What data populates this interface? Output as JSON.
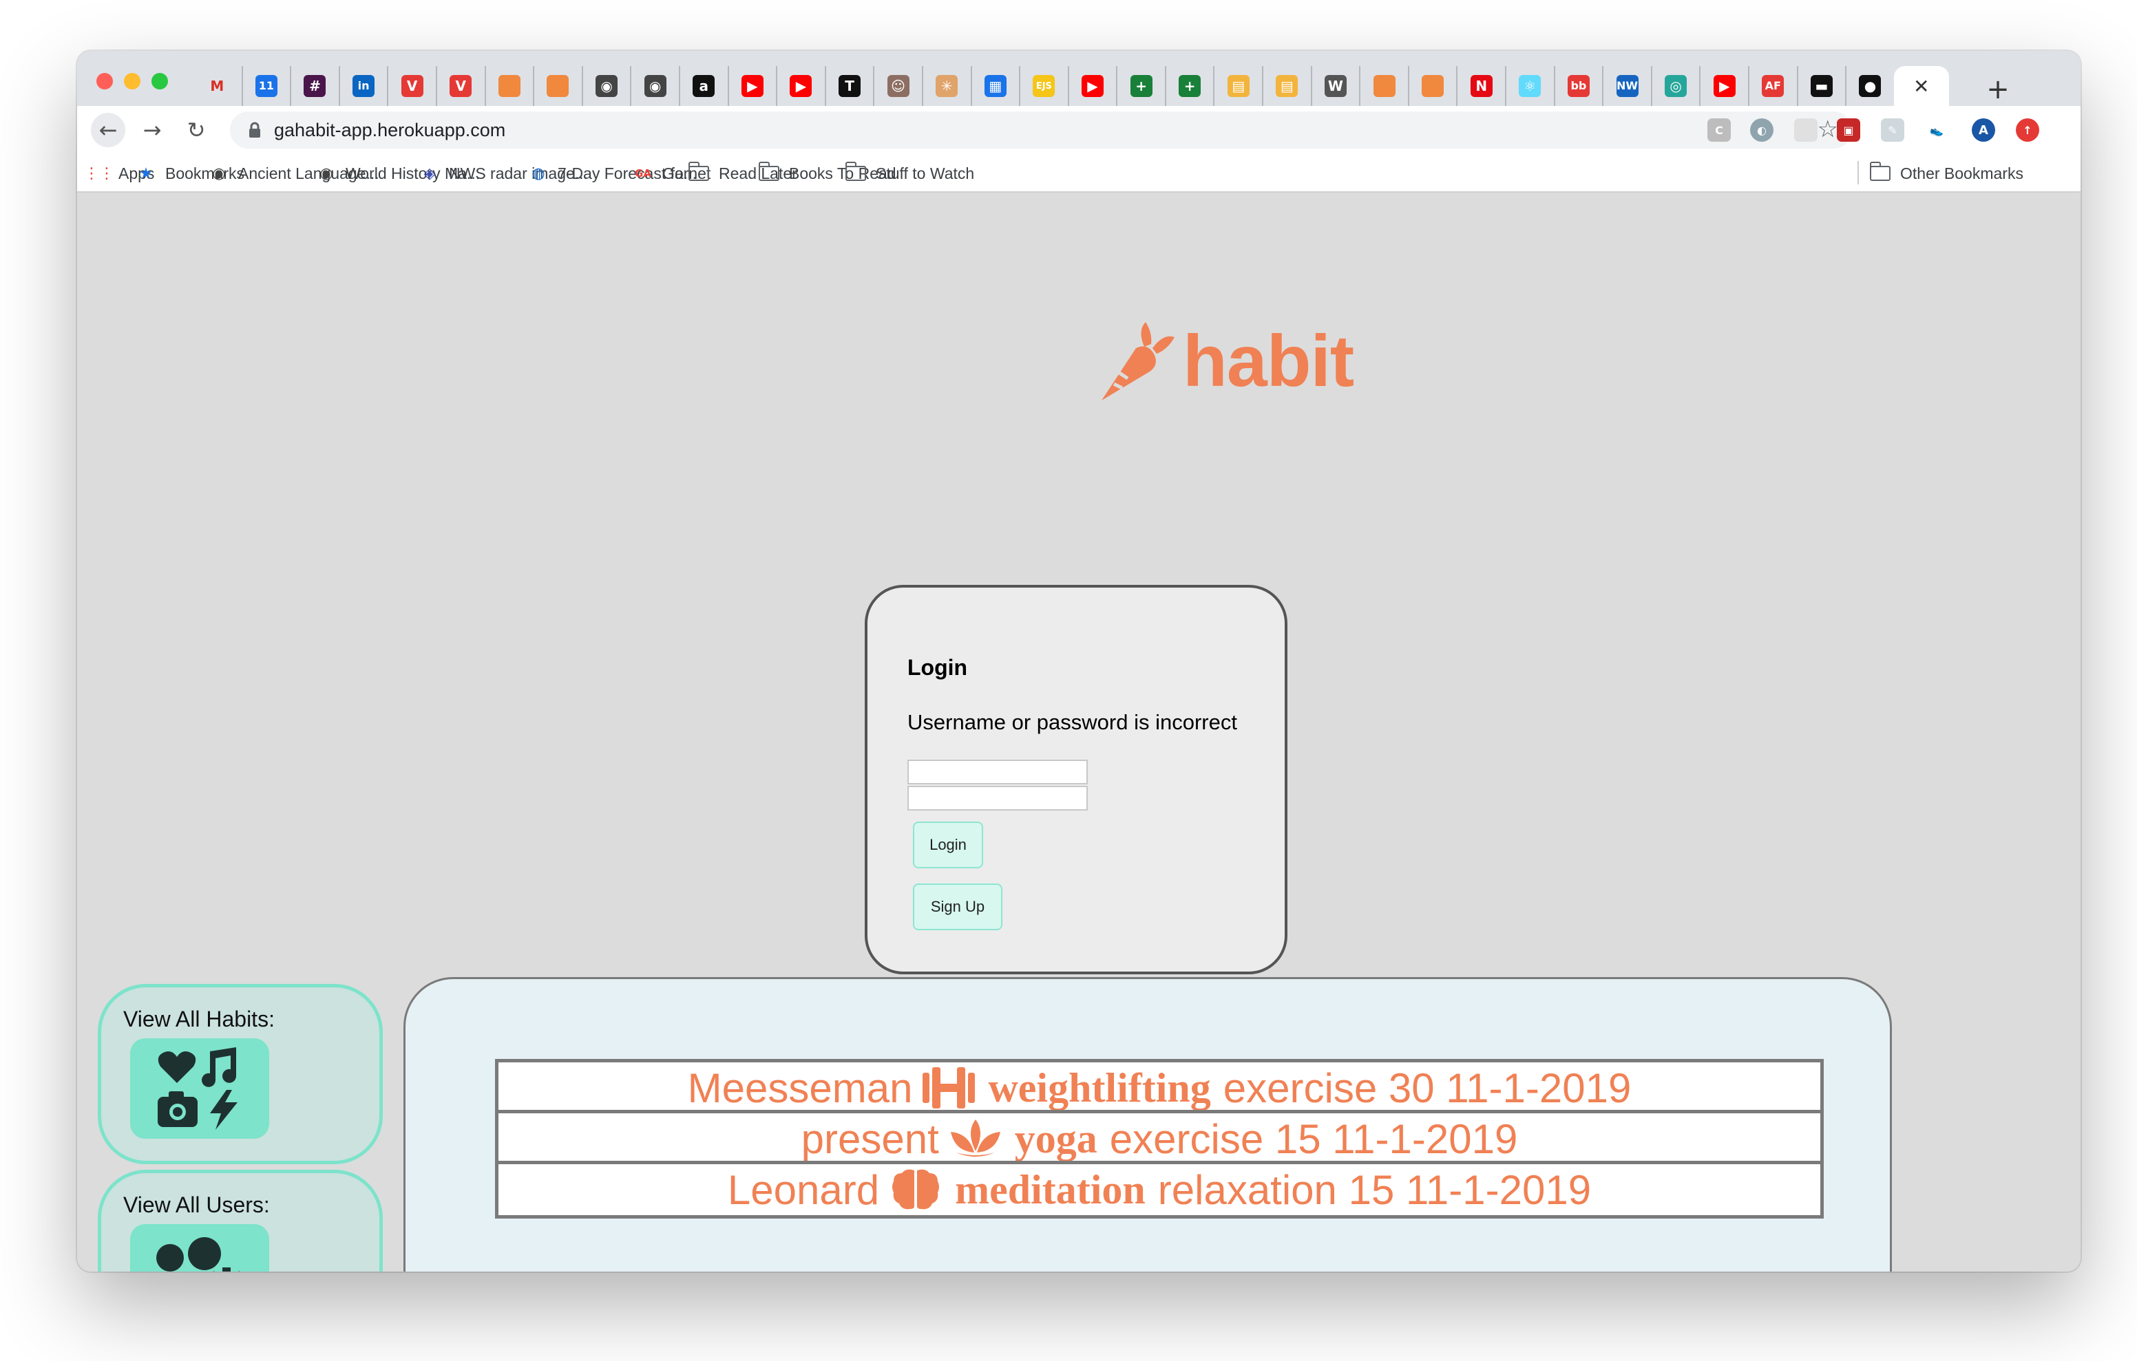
{
  "browser": {
    "tabs": [
      {
        "icon": "gmail-icon",
        "glyph": "M",
        "color": "#d93025",
        "text_color": "#d93025",
        "bg": "transparent"
      },
      {
        "icon": "calendar-icon",
        "glyph": "11",
        "color": "#1a73e8"
      },
      {
        "icon": "slack-icon",
        "glyph": "#",
        "color": "#4a154b"
      },
      {
        "icon": "linkedin-icon",
        "glyph": "in",
        "color": "#0a66c2"
      },
      {
        "icon": "v-red-icon",
        "glyph": "V",
        "color": "#e53935"
      },
      {
        "icon": "v-red-icon",
        "glyph": "V",
        "color": "#e53935"
      },
      {
        "icon": "cube-orange-icon",
        "glyph": "",
        "color": "#f0883e"
      },
      {
        "icon": "cube-orange-icon",
        "glyph": "",
        "color": "#f0883e"
      },
      {
        "icon": "globe-icon",
        "glyph": "◉",
        "color": "#444444"
      },
      {
        "icon": "globe-icon",
        "glyph": "◉",
        "color": "#444444"
      },
      {
        "icon": "amazon-icon",
        "glyph": "a",
        "color": "#111111"
      },
      {
        "icon": "youtube-icon",
        "glyph": "▶",
        "color": "#ff0000"
      },
      {
        "icon": "youtube-icon",
        "glyph": "▶",
        "color": "#ff0000"
      },
      {
        "icon": "nytimes-icon",
        "glyph": "T",
        "color": "#111111"
      },
      {
        "icon": "meerkat-icon",
        "glyph": "☺",
        "color": "#8d6e63"
      },
      {
        "icon": "asterisk-icon",
        "glyph": "✳",
        "color": "#e0a36a"
      },
      {
        "icon": "grid-blue-icon",
        "glyph": "▦",
        "color": "#1a73e8"
      },
      {
        "icon": "ejs-icon",
        "glyph": "EJS",
        "color": "#f5c518"
      },
      {
        "icon": "youtube-icon",
        "glyph": "▶",
        "color": "#ff0000"
      },
      {
        "icon": "sheets-icon",
        "glyph": "+",
        "color": "#188038"
      },
      {
        "icon": "sheets-icon",
        "glyph": "+",
        "color": "#188038"
      },
      {
        "icon": "book-icon",
        "glyph": "▤",
        "color": "#f2b43c"
      },
      {
        "icon": "book-icon",
        "glyph": "▤",
        "color": "#f2b43c"
      },
      {
        "icon": "wikipedia-icon",
        "glyph": "W",
        "color": "#555555"
      },
      {
        "icon": "cube-orange-icon",
        "glyph": "",
        "color": "#f0883e"
      },
      {
        "icon": "cube-orange-icon",
        "glyph": "",
        "color": "#f0883e"
      },
      {
        "icon": "netflix-icon",
        "glyph": "N",
        "color": "#e50914"
      },
      {
        "icon": "react-icon",
        "glyph": "⚛",
        "color": "#61dafb"
      },
      {
        "icon": "bb-icon",
        "glyph": "bb",
        "color": "#e53935"
      },
      {
        "icon": "nw-icon",
        "glyph": "NW",
        "color": "#1565c0"
      },
      {
        "icon": "eye-icon",
        "glyph": "◎",
        "color": "#26a69a"
      },
      {
        "icon": "youtube-icon",
        "glyph": "▶",
        "color": "#ff0000"
      },
      {
        "icon": "af-icon",
        "glyph": "AF",
        "color": "#e53935"
      },
      {
        "icon": "film-icon",
        "glyph": "▬",
        "color": "#111111"
      },
      {
        "icon": "github-icon",
        "glyph": "●",
        "color": "#111111"
      }
    ],
    "active_tab_close": "✕",
    "new_tab": "+",
    "address": {
      "url": "gahabit-app.herokuapp.com"
    },
    "bookmarks": [
      {
        "icon": "apps-grid-icon",
        "label": "Apps"
      },
      {
        "icon": "star-icon",
        "label": "Bookmarks"
      },
      {
        "icon": "globe-icon",
        "label": "Ancient Language..."
      },
      {
        "icon": "globe-icon",
        "label": "World History Ma..."
      },
      {
        "icon": "radar-icon",
        "label": "NWS radar image..."
      },
      {
        "icon": "noaa-icon",
        "label": "7-Day Forecast fo..."
      },
      {
        "icon": "ga-icon",
        "icon_text": "GA",
        "label": "Garnet"
      },
      {
        "icon": "folder-icon",
        "label": "Read Later"
      },
      {
        "icon": "folder-icon",
        "label": "Books To Read"
      },
      {
        "icon": "folder-icon",
        "label": "Stuff to Watch"
      }
    ],
    "other_bookmarks": "Other Bookmarks",
    "profile_initial": "A"
  },
  "page": {
    "logo_text": "habit",
    "brand_color": "#f08154",
    "accent_color": "#7de3cb",
    "login": {
      "title": "Login",
      "error": "Username or password is incorrect",
      "username_value": "",
      "password_value": "",
      "login_button": "Login",
      "signup_button": "Sign Up"
    },
    "sidebar": [
      {
        "label": "View All Habits:",
        "icon": "habits-collage-icon"
      },
      {
        "label": "View All Users:",
        "icon": "users-gear-icon"
      }
    ],
    "feed": [
      {
        "user": "Meesseman",
        "icon": "dumbbell-icon",
        "habit": "weightlifting",
        "details": "exercise 30 11-1-2019"
      },
      {
        "user": "present",
        "icon": "lotus-icon",
        "habit": "yoga",
        "details": "exercise 15 11-1-2019"
      },
      {
        "user": "Leonard",
        "icon": "brain-icon",
        "habit": "meditation",
        "details": "relaxation 15 11-1-2019"
      }
    ]
  }
}
